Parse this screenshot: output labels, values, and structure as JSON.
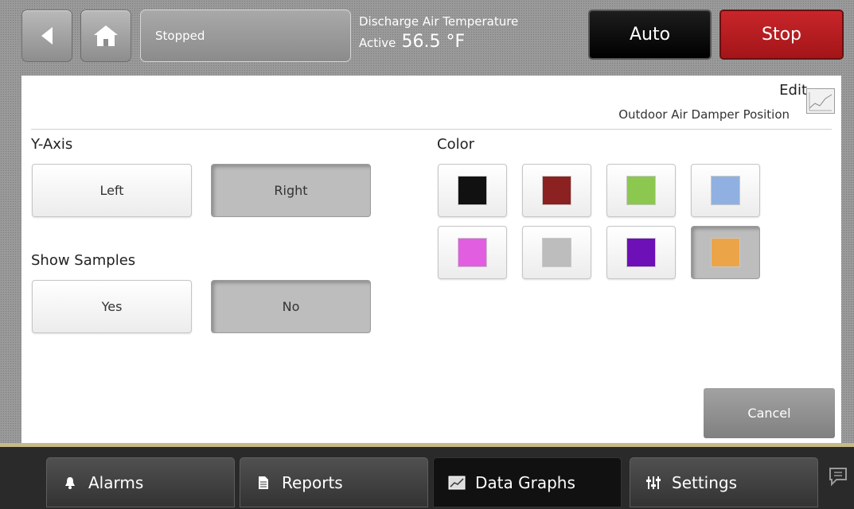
{
  "header": {
    "status": "Stopped",
    "point_name": "Discharge Air Temperature",
    "point_state": "Active",
    "point_value": "56.5 °F",
    "auto_label": "Auto",
    "stop_label": "Stop"
  },
  "edit": {
    "title": "Edit",
    "subtitle": "Outdoor Air Damper Position"
  },
  "y_axis": {
    "label": "Y-Axis",
    "options": [
      "Left",
      "Right"
    ],
    "selected": "Right"
  },
  "show_samples": {
    "label": "Show Samples",
    "options": [
      "Yes",
      "No"
    ],
    "selected": "No"
  },
  "color": {
    "label": "Color",
    "swatches": [
      "#111111",
      "#8b2121",
      "#8cc850",
      "#8fb0e0",
      "#e15ee1",
      "#bdbdbd",
      "#6d10b8",
      "#eba548"
    ],
    "selected": "#eba548"
  },
  "cancel_label": "Cancel",
  "tabs": [
    {
      "label": "Alarms",
      "icon": "bell-icon"
    },
    {
      "label": "Reports",
      "icon": "document-icon"
    },
    {
      "label": "Data Graphs",
      "icon": "graph-icon"
    },
    {
      "label": "Settings",
      "icon": "sliders-icon"
    }
  ],
  "active_tab": "Data Graphs"
}
